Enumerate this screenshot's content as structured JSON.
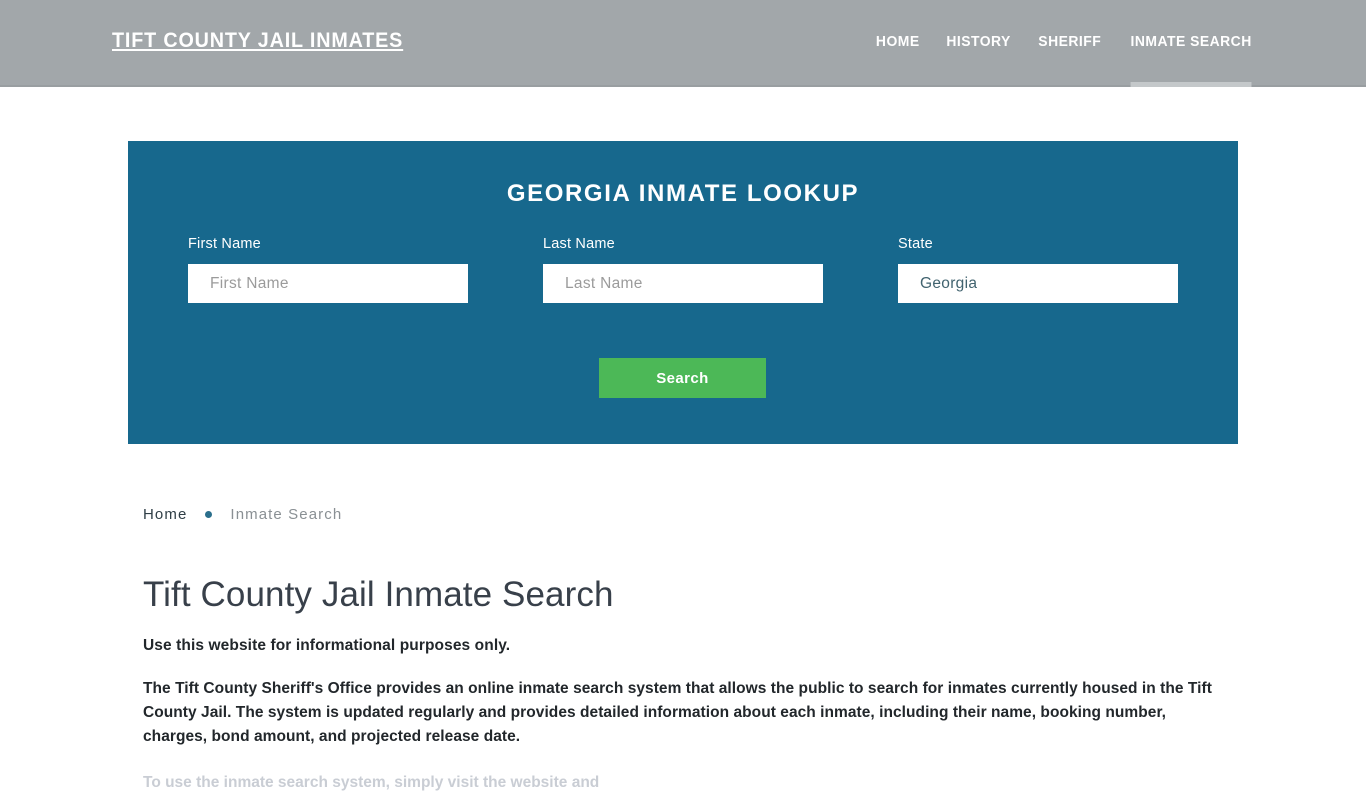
{
  "header": {
    "brand": "TIFT COUNTY JAIL INMATES",
    "nav": [
      {
        "label": "HOME",
        "active": false
      },
      {
        "label": "HISTORY",
        "active": false
      },
      {
        "label": "SHERIFF",
        "active": false
      },
      {
        "label": "INMATE SEARCH",
        "active": true
      }
    ]
  },
  "lookup": {
    "title": "GEORGIA INMATE LOOKUP",
    "fields": {
      "first_name": {
        "label": "First Name",
        "placeholder": "First Name",
        "value": ""
      },
      "last_name": {
        "label": "Last Name",
        "placeholder": "Last Name",
        "value": ""
      },
      "state": {
        "label": "State",
        "placeholder": "State",
        "value": "Georgia"
      }
    },
    "search_button": "Search"
  },
  "breadcrumb": {
    "home": "Home",
    "current": "Inmate Search"
  },
  "main": {
    "title": "Tift County Jail Inmate Search",
    "lead": "Use this website for informational purposes only.",
    "paragraph": "The Tift County Sheriff's Office provides an online inmate search system that allows the public to search for inmates currently housed in the Tift County Jail. The system is updated regularly and provides detailed information about each inmate, including their name, booking number, charges, bond amount, and projected release date.",
    "next_paragraph_partial": "To use the inmate search system, simply visit the website and"
  },
  "colors": {
    "header_gray": "#a2a7aa",
    "panel_blue": "#17688d",
    "button_green": "#4cb857",
    "breadcrumb_dot": "#2b6f8c",
    "title_slate": "#38404a"
  }
}
